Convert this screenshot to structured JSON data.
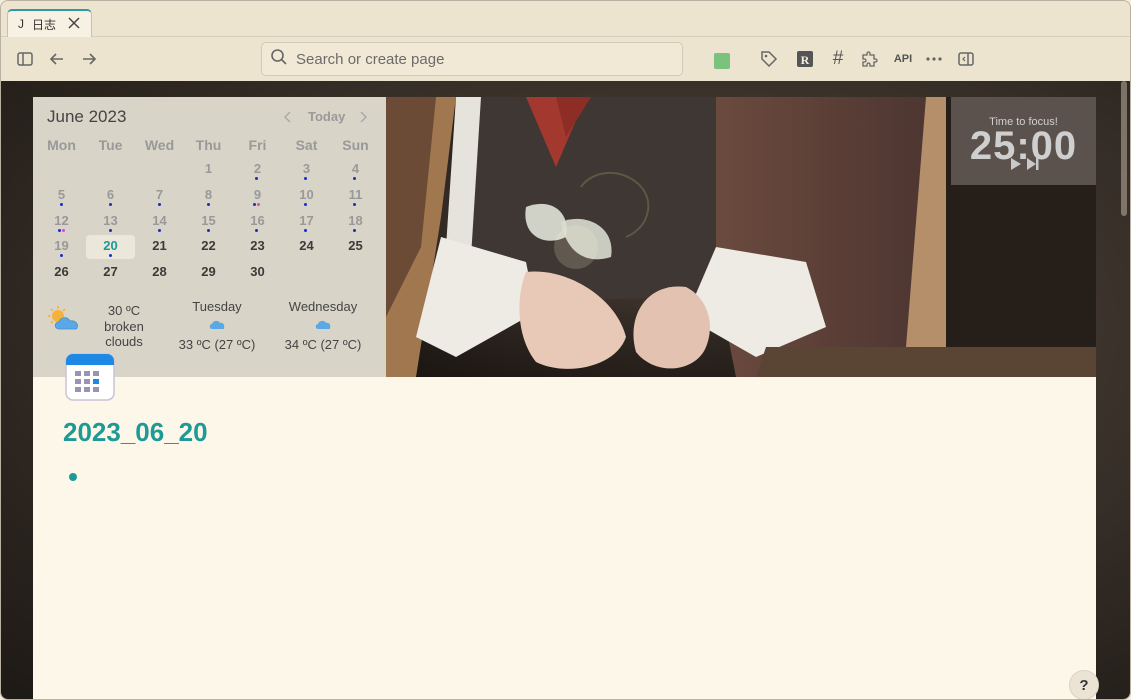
{
  "tab": {
    "icon_letter": "J",
    "title": "日志"
  },
  "toolbar": {
    "search_placeholder": "Search or create page",
    "api_label": "API",
    "accent_swatch_color": "#7bc27f"
  },
  "calendar": {
    "title": "June 2023",
    "today_label": "Today",
    "weekdays": [
      "Mon",
      "Tue",
      "Wed",
      "Thu",
      "Fri",
      "Sat",
      "Sun"
    ],
    "weeks": [
      [
        "",
        "",
        "",
        "1",
        "2",
        "3",
        "4"
      ],
      [
        "5",
        "6",
        "7",
        "8",
        "9",
        "10",
        "11"
      ],
      [
        "12",
        "13",
        "14",
        "15",
        "16",
        "17",
        "18"
      ],
      [
        "19",
        "20",
        "21",
        "22",
        "23",
        "24",
        "25"
      ],
      [
        "26",
        "27",
        "28",
        "29",
        "30",
        "",
        ""
      ]
    ],
    "today": "20"
  },
  "weather": {
    "current_temp": "30 ºC",
    "current_desc_1": "broken",
    "current_desc_2": "clouds",
    "forecast": [
      {
        "day": "Tuesday",
        "temp": "33 ºC (27 ºC)"
      },
      {
        "day": "Wednesday",
        "temp": "34 ºC (27 ºC)"
      }
    ]
  },
  "pomodoro": {
    "title": "Time to focus!",
    "time": "25:00"
  },
  "page": {
    "title": "2023_06_20"
  },
  "help": {
    "label": "?"
  }
}
